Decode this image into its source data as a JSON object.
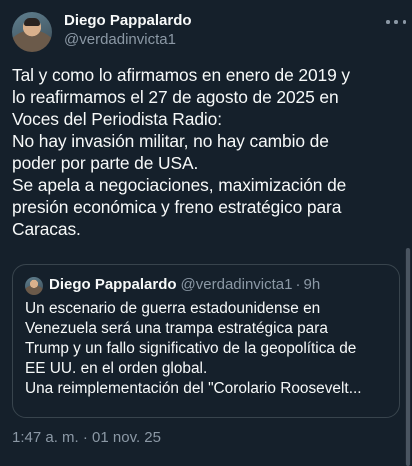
{
  "tweet": {
    "author": {
      "name": "Diego Pappalardo",
      "handle": "@verdadinvicta1"
    },
    "text_lines": [
      "Tal y como lo afirmamos en enero de 2019 y",
      "lo reafirmamos el 27 de agosto de 2025 en",
      "Voces del Periodista Radio:",
      "No hay invasión militar, no hay cambio de",
      "poder por parte de USA.",
      "Se apela a negociaciones,  maximización de",
      "presión económica y freno estratégico para",
      "Caracas."
    ],
    "quoted": {
      "name": "Diego Pappalardo",
      "handle": "@verdadinvicta1",
      "separator": "·",
      "time": "9h",
      "text_lines": [
        "Un escenario de guerra estadounidense en",
        "Venezuela será una trampa estratégica para",
        "Trump y un fallo significativo de la geopolítica de",
        "EE UU. en el orden global.",
        "Una reimplementación del \"Corolario  Roosevelt..."
      ]
    },
    "timestamp": "1:47 a. m. · 01 nov. 25"
  },
  "icons": {
    "more": "more-horizontal-icon"
  },
  "colors": {
    "background": "#15202b",
    "text_primary": "#f7f9f9",
    "text_secondary": "#8b98a5",
    "border": "#38444d"
  }
}
